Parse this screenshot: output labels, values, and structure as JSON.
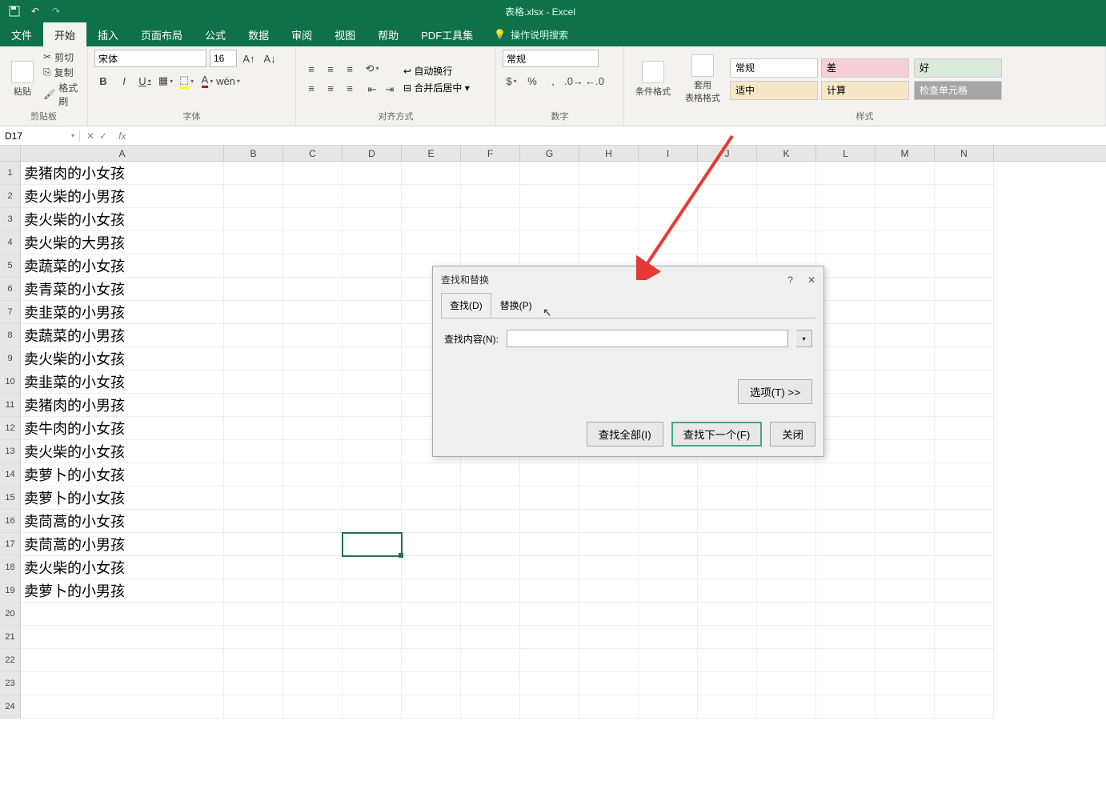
{
  "title": "表格.xlsx - Excel",
  "tabs": {
    "file": "文件",
    "home": "开始",
    "insert": "插入",
    "layout": "页面布局",
    "formulas": "公式",
    "data": "数据",
    "review": "审阅",
    "view": "视图",
    "help": "帮助",
    "pdf": "PDF工具集",
    "tellme": "操作说明搜索"
  },
  "ribbon": {
    "clipboard": {
      "label": "剪贴板",
      "paste": "粘贴",
      "cut": "剪切",
      "copy": "复制",
      "painter": "格式刷"
    },
    "font": {
      "label": "字体",
      "name": "宋体",
      "size": "16",
      "bold": "B",
      "italic": "I",
      "underline": "U"
    },
    "alignment": {
      "label": "对齐方式",
      "wrap": "自动换行",
      "merge": "合并后居中"
    },
    "number": {
      "label": "数字",
      "format": "常规"
    },
    "styles": {
      "label": "样式",
      "cond": "条件格式",
      "table": "套用\n表格格式",
      "normal": "常规",
      "bad": "差",
      "good": "好",
      "mid": "适中",
      "calc": "计算",
      "check": "检查单元格"
    }
  },
  "namebox": "D17",
  "columns": [
    "A",
    "B",
    "C",
    "D",
    "E",
    "F",
    "G",
    "H",
    "I",
    "J",
    "K",
    "L",
    "M",
    "N"
  ],
  "rows": [
    "卖猪肉的小女孩",
    "卖火柴的小男孩",
    "卖火柴的小女孩",
    "卖火柴的大男孩",
    "卖蔬菜的小女孩",
    "卖青菜的小女孩",
    "卖韭菜的小男孩",
    "卖蔬菜的小男孩",
    "卖火柴的小女孩",
    "卖韭菜的小女孩",
    "卖猪肉的小男孩",
    "卖牛肉的小女孩",
    "卖火柴的小女孩",
    "卖萝卜的小女孩",
    "卖萝卜的小女孩",
    "卖茼蒿的小女孩",
    "卖茼蒿的小男孩",
    "卖火柴的小女孩",
    "卖萝卜的小男孩"
  ],
  "blank_rows": [
    20,
    21,
    22,
    23,
    24
  ],
  "dialog": {
    "title": "查找和替换",
    "tab_find": "查找(D)",
    "tab_replace": "替换(P)",
    "find_label": "查找内容(N):",
    "options": "选项(T) >>",
    "find_all": "查找全部(I)",
    "find_next": "查找下一个(F)",
    "close": "关闭",
    "help": "?",
    "x": "✕"
  }
}
